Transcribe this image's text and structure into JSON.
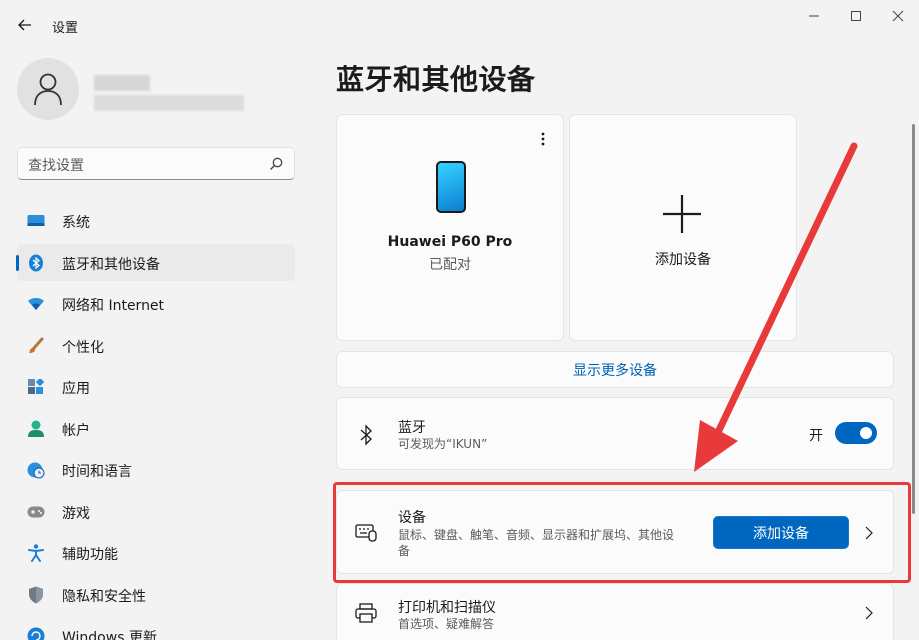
{
  "window": {
    "title": "设置"
  },
  "search": {
    "placeholder": "查找设置"
  },
  "sidebar": {
    "items": [
      {
        "label": "系统",
        "icon": "system-icon"
      },
      {
        "label": "蓝牙和其他设备",
        "icon": "bluetooth-icon",
        "active": true
      },
      {
        "label": "网络和 Internet",
        "icon": "wifi-icon"
      },
      {
        "label": "个性化",
        "icon": "brush-icon"
      },
      {
        "label": "应用",
        "icon": "apps-icon"
      },
      {
        "label": "帐户",
        "icon": "account-icon"
      },
      {
        "label": "时间和语言",
        "icon": "clock-globe-icon"
      },
      {
        "label": "游戏",
        "icon": "gamepad-icon"
      },
      {
        "label": "辅助功能",
        "icon": "accessibility-icon"
      },
      {
        "label": "隐私和安全性",
        "icon": "shield-icon"
      },
      {
        "label": "Windows 更新",
        "icon": "update-icon"
      }
    ]
  },
  "main": {
    "title": "蓝牙和其他设备",
    "device_card": {
      "name": "Huawei P60 Pro",
      "status": "已配对"
    },
    "add_card": {
      "label": "添加设备"
    },
    "show_more": "显示更多设备",
    "bluetooth": {
      "title": "蓝牙",
      "subtitle": "可发现为“IKUN”",
      "toggle_label": "开",
      "enabled": true
    },
    "devices": {
      "title": "设备",
      "subtitle_line1": "鼠标、键盘、触笔、音频、显示器和扩展坞、其他设",
      "subtitle_line2": "备",
      "button": "添加设备"
    },
    "printers": {
      "title": "打印机和扫描仪",
      "subtitle": "首选项、疑难解答"
    }
  },
  "colors": {
    "accent": "#0067c0",
    "annotation": "#e83a3a"
  }
}
